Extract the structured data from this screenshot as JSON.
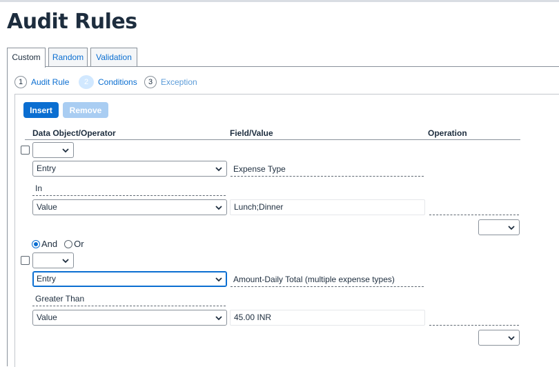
{
  "page": {
    "title": "Audit Rules"
  },
  "tabs": [
    {
      "label": "Custom",
      "active": true
    },
    {
      "label": "Random",
      "active": false
    },
    {
      "label": "Validation",
      "active": false
    }
  ],
  "steps": [
    {
      "number": "1",
      "label": "Audit Rule"
    },
    {
      "number": "2",
      "label": "Conditions"
    },
    {
      "number": "3",
      "label": "Exception"
    }
  ],
  "toolbar": {
    "insert_label": "Insert",
    "remove_label": "Remove"
  },
  "columns": {
    "data_object": "Data Object/Operator",
    "field_value": "Field/Value",
    "operation": "Operation"
  },
  "conditions": [
    {
      "data_object": "Entry",
      "field": "Expense Type",
      "operator": "In",
      "value_type": "Value",
      "value": "Lunch;Dinner"
    },
    {
      "data_object": "Entry",
      "field": "Amount-Daily Total (multiple expense types)",
      "operator": "Greater Than",
      "value_type": "Value",
      "value": "45.00 INR"
    }
  ],
  "logic": {
    "and_label": "And",
    "or_label": "Or",
    "selected": "And"
  },
  "icons": {
    "dropdown": "chevron-down-icon"
  },
  "colors": {
    "accent": "#0a6ed1",
    "text": "#1d2d3e",
    "disabled_button": "#a9cdf2"
  }
}
